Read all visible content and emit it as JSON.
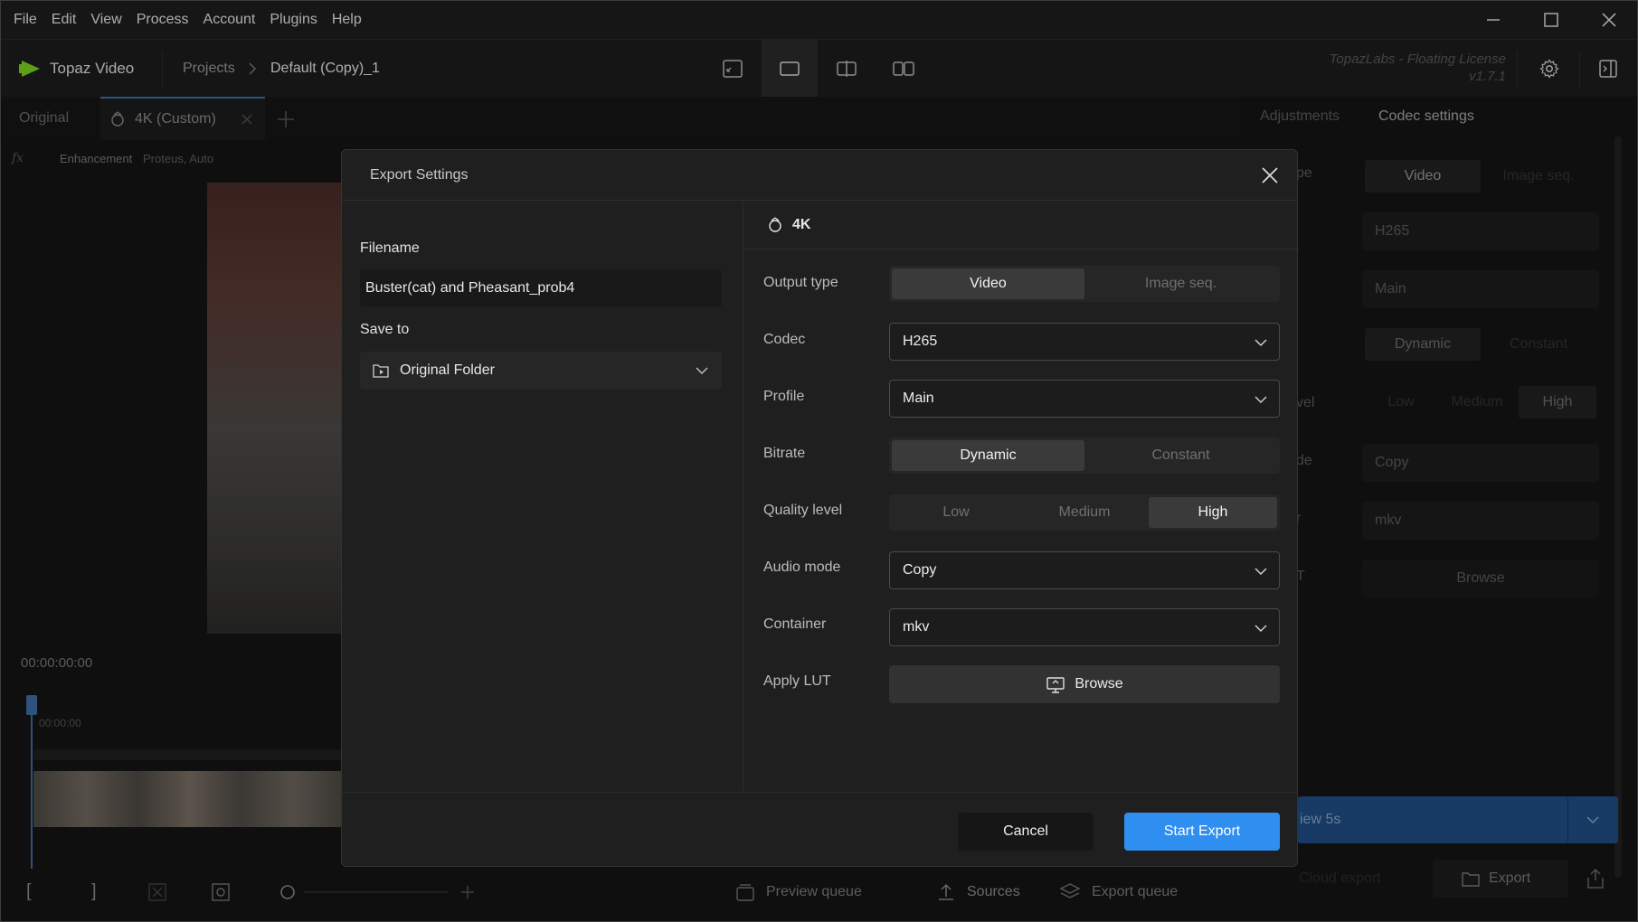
{
  "menu": [
    "File",
    "Edit",
    "View",
    "Process",
    "Account",
    "Plugins",
    "Help"
  ],
  "app": {
    "logo_text": "Topaz Video",
    "breadcrumb_root": "Projects",
    "breadcrumb_current": "Default (Copy)_1",
    "license_line1": "TopazLabs - Floating License",
    "license_line2": "v1.7.1"
  },
  "tabs": {
    "original": "Original",
    "custom": "4K (Custom)"
  },
  "enhancement": {
    "label": "Enhancement",
    "value": "Proteus, Auto"
  },
  "timeline": {
    "timecode": "00:00:00:00",
    "marker": "00:00:00"
  },
  "bottom": {
    "preview_queue": "Preview queue",
    "sources": "Sources",
    "export_queue": "Export queue"
  },
  "right_panel": {
    "tab_adjustments": "Adjustments",
    "tab_codec": "Codec settings",
    "label_type_frag": "pe",
    "label_level_frag": "vel",
    "label_mode_frag": "de",
    "label_r_frag": "r",
    "label_t_frag": "T",
    "video": "Video",
    "image_seq": "Image seq.",
    "codec": "H265",
    "profile": "Main",
    "dynamic": "Dynamic",
    "constant": "Constant",
    "low": "Low",
    "medium": "Medium",
    "high": "High",
    "audio": "Copy",
    "container": "mkv",
    "browse": "Browse",
    "preview_btn_frag": "iew 5s",
    "cloud_export": "Cloud export",
    "export": "Export"
  },
  "modal": {
    "title": "Export Settings",
    "filename_label": "Filename",
    "filename_value": "Buster(cat) and Pheasant_prob4",
    "save_to_label": "Save to",
    "save_to_value": "Original Folder",
    "preset_name": "4K",
    "rows": {
      "output_type": "Output type",
      "codec": "Codec",
      "profile": "Profile",
      "bitrate": "Bitrate",
      "quality": "Quality level",
      "audio": "Audio mode",
      "container": "Container",
      "lut": "Apply LUT"
    },
    "output_type_options": [
      "Video",
      "Image seq."
    ],
    "codec_value": "H265",
    "profile_value": "Main",
    "bitrate_options": [
      "Dynamic",
      "Constant"
    ],
    "quality_options": [
      "Low",
      "Medium",
      "High"
    ],
    "audio_value": "Copy",
    "container_value": "mkv",
    "lut_button": "Browse",
    "cancel": "Cancel",
    "start_export": "Start Export"
  },
  "colors": {
    "accent": "#2f8ff0",
    "play": "#7ed321"
  }
}
